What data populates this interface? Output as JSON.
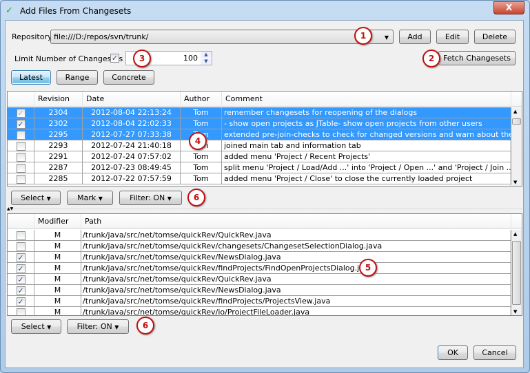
{
  "window": {
    "title": "Add Files From Changesets",
    "close_label": "X"
  },
  "repository": {
    "label": "Repository",
    "value": "file:///D:/repos/svn/trunk/",
    "add": "Add",
    "edit": "Edit",
    "delete": "Delete"
  },
  "limit": {
    "label": "Limit Number of Changesets",
    "checked": true,
    "value": "100",
    "fetch": "Fetch Changesets"
  },
  "modes": {
    "latest": "Latest",
    "range": "Range",
    "concrete": "Concrete",
    "selected": "Latest"
  },
  "changesets": {
    "columns": [
      "",
      "Revision",
      "Date",
      "Author",
      "Comment"
    ],
    "rows": [
      {
        "checked": true,
        "disabled": true,
        "selected": true,
        "revision": "2304",
        "date": "2012-08-04 22:13:24",
        "author": "Tom",
        "comment": "remember changesets for reopening of the dialogs"
      },
      {
        "checked": true,
        "selected": true,
        "revision": "2302",
        "date": "2012-08-04 22:02:33",
        "author": "Tom",
        "comment": "- show open projects as JTable- show open projects from other users"
      },
      {
        "checked": false,
        "selected": true,
        "revision": "2295",
        "date": "2012-07-27 07:33:38",
        "author": "Tom",
        "comment": "extended pre-join-checks to check for changed versions and warn about them"
      },
      {
        "checked": false,
        "revision": "2293",
        "date": "2012-07-24 21:40:18",
        "author": "Tom",
        "comment": "joined main tab and information tab"
      },
      {
        "checked": false,
        "revision": "2291",
        "date": "2012-07-24 07:57:02",
        "author": "Tom",
        "comment": "added menu 'Project / Recent Projects'"
      },
      {
        "checked": false,
        "revision": "2287",
        "date": "2012-07-23 08:49:45",
        "author": "Tom",
        "comment": "split menu 'Project / Load/Add ...' into 'Project / Open ...' and 'Project / Join ...'"
      },
      {
        "checked": false,
        "revision": "2285",
        "date": "2012-07-22 07:57:59",
        "author": "Tom",
        "comment": "added menu 'Project / Close' to close the currently loaded project"
      }
    ],
    "select": "Select",
    "mark": "Mark",
    "filter": "Filter: ON"
  },
  "files": {
    "columns": [
      "",
      "Modifier",
      "Path"
    ],
    "rows": [
      {
        "checked": false,
        "modifier": "M",
        "path": "/trunk/java/src/net/tomse/quickRev/QuickRev.java"
      },
      {
        "checked": false,
        "modifier": "M",
        "path": "/trunk/java/src/net/tomse/quickRev/changesets/ChangesetSelectionDialog.java"
      },
      {
        "checked": true,
        "modifier": "M",
        "path": "/trunk/java/src/net/tomse/quickRev/NewsDialog.java"
      },
      {
        "checked": true,
        "modifier": "M",
        "path": "/trunk/java/src/net/tomse/quickRev/findProjects/FindOpenProjectsDialog.java"
      },
      {
        "checked": true,
        "modifier": "M",
        "path": "/trunk/java/src/net/tomse/quickRev/QuickRev.java"
      },
      {
        "checked": true,
        "modifier": "M",
        "path": "/trunk/java/src/net/tomse/quickRev/NewsDialog.java"
      },
      {
        "checked": true,
        "modifier": "M",
        "path": "/trunk/java/src/net/tomse/quickRev/findProjects/ProjectsView.java"
      },
      {
        "checked": false,
        "modifier": "M",
        "path": "/trunk/java/src/net/tomse/quickRev/io/ProjectFileLoader.java"
      }
    ],
    "select": "Select",
    "filter": "Filter: ON"
  },
  "footer": {
    "ok": "OK",
    "cancel": "Cancel"
  },
  "callouts": [
    "1",
    "2",
    "3",
    "4",
    "5",
    "6",
    "6"
  ],
  "colors": {
    "selection": "#3399ff",
    "callout": "#c01010"
  }
}
